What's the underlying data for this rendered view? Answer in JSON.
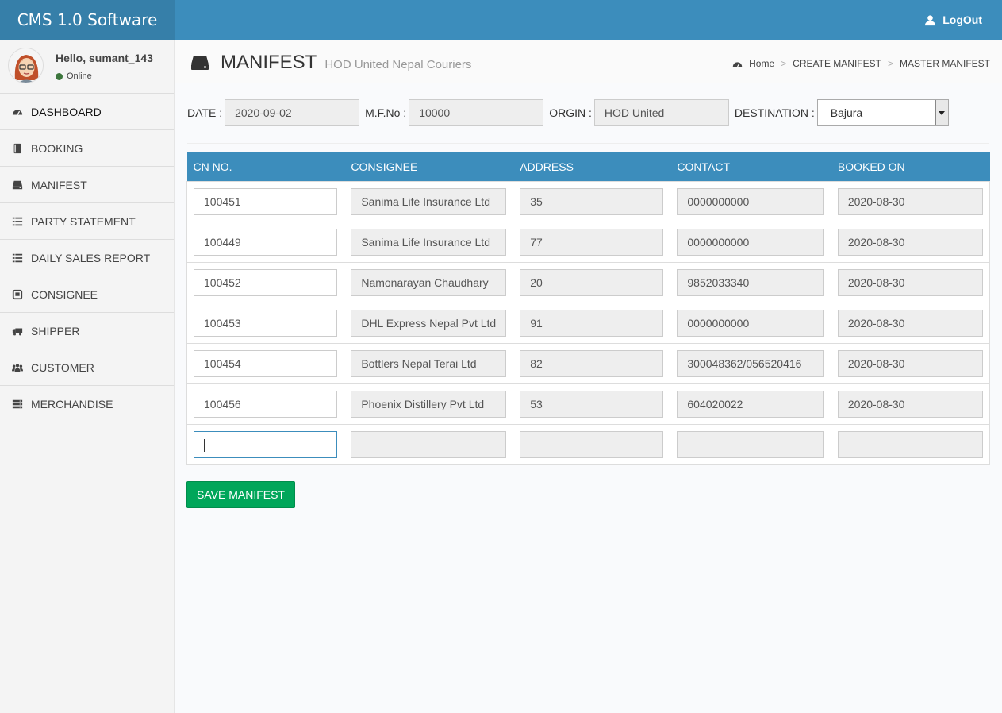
{
  "app": {
    "title": "CMS 1.0 Software",
    "logout_label": "LogOut"
  },
  "user": {
    "greeting": "Hello, sumant_143",
    "status": "Online"
  },
  "sidebar": {
    "items": [
      {
        "label": "DASHBOARD",
        "icon": "dashboard-icon"
      },
      {
        "label": "BOOKING",
        "icon": "book-icon"
      },
      {
        "label": "MANIFEST",
        "icon": "hdd-icon"
      },
      {
        "label": "PARTY STATEMENT",
        "icon": "list-icon"
      },
      {
        "label": "DAILY SALES REPORT",
        "icon": "list-icon"
      },
      {
        "label": "CONSIGNEE",
        "icon": "box-icon"
      },
      {
        "label": "SHIPPER",
        "icon": "truck-icon"
      },
      {
        "label": "CUSTOMER",
        "icon": "users-icon"
      },
      {
        "label": "MERCHANDISE",
        "icon": "server-icon"
      }
    ]
  },
  "header": {
    "title": "MANIFEST",
    "subtitle": "HOD United Nepal Couriers",
    "breadcrumb": [
      "Home",
      "CREATE MANIFEST",
      "MASTER MANIFEST"
    ]
  },
  "form": {
    "date_label": "DATE :",
    "date_value": "2020-09-02",
    "mfno_label": "M.F.No :",
    "mfno_value": "10000",
    "origin_label": "ORGIN :",
    "origin_value": "HOD United",
    "destination_label": "DESTINATION :",
    "destination_value": "Bajura"
  },
  "table": {
    "headers": [
      "CN NO.",
      "CONSIGNEE",
      "ADDRESS",
      "CONTACT",
      "BOOKED ON"
    ],
    "rows": [
      [
        "100451",
        "Sanima Life Insurance Ltd",
        "35",
        "0000000000",
        "2020-08-30"
      ],
      [
        "100449",
        "Sanima Life Insurance Ltd",
        "77",
        "0000000000",
        "2020-08-30"
      ],
      [
        "100452",
        "Namonarayan Chaudhary",
        "20",
        "9852033340",
        "2020-08-30"
      ],
      [
        "100453",
        "DHL Express Nepal Pvt Ltd",
        "91",
        "0000000000",
        "2020-08-30"
      ],
      [
        "100454",
        "Bottlers Nepal Terai Ltd",
        "82",
        "300048362/056520416",
        "2020-08-30"
      ],
      [
        "100456",
        "Phoenix Distillery Pvt Ltd",
        "53",
        "604020022",
        "2020-08-30"
      ],
      [
        "",
        "",
        "",
        "",
        ""
      ]
    ]
  },
  "actions": {
    "save_label": "SAVE MANIFEST"
  },
  "colors": {
    "primary": "#3c8dbc",
    "logo_bg": "#367fa9",
    "success": "#00a65a"
  }
}
